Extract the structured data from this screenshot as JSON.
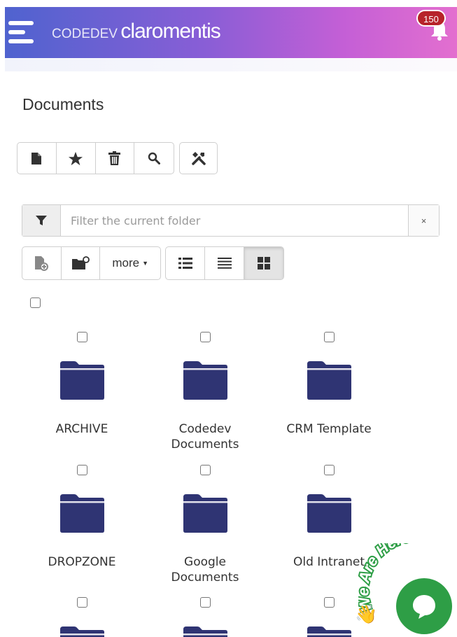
{
  "header": {
    "brand_prefix": "CODEDEV",
    "brand_name": "claromentis",
    "notification_count": "150",
    "gradient_start": "#4f63cf",
    "gradient_end": "#e36fcf"
  },
  "page": {
    "title": "Documents"
  },
  "toolbar": {
    "icons": [
      "new-document-icon",
      "star-icon",
      "trash-icon",
      "search-icon",
      "tools-icon"
    ]
  },
  "filter": {
    "placeholder": "Filter the current folder",
    "value": "",
    "clear_label": "×"
  },
  "view_toolbar": {
    "more_label": "more",
    "view_modes": [
      "detailed-list-icon",
      "list-icon",
      "grid-icon"
    ],
    "active_view": "grid"
  },
  "folders": [
    {
      "name": "ARCHIVE"
    },
    {
      "name": "Codedev Documents"
    },
    {
      "name": "CRM Template"
    },
    {
      "name": "DROPZONE"
    },
    {
      "name": "Google Documents"
    },
    {
      "name": "Old Intranet"
    },
    {
      "name": ""
    },
    {
      "name": ""
    },
    {
      "name": ""
    }
  ],
  "folder_color": "#2f3473",
  "chat_widget": {
    "label": "We Are Here!",
    "color": "#2e9e46"
  }
}
